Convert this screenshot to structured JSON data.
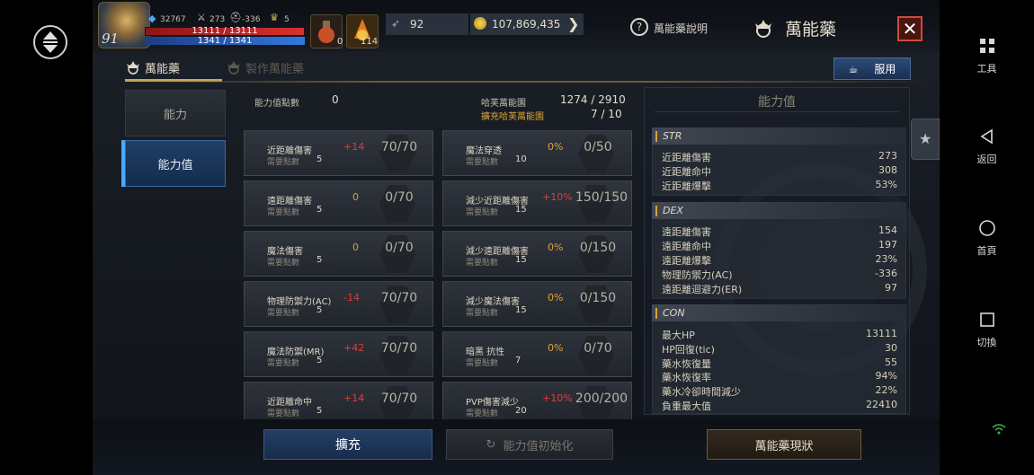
{
  "header": {
    "level": "91",
    "stat_crystal": "32767",
    "stat_sword": "273",
    "stat_helmet": "-336",
    "stat_trophy": "5",
    "hp": "13111 / 13111",
    "mp": "1341 / 1341",
    "item1_count": "0",
    "item2_count": "114",
    "crystals": "92",
    "gold": "107,869,435",
    "help_label": "萬能藥說明",
    "title": "萬能藥",
    "close_label": "✕"
  },
  "tabs": [
    {
      "label": "萬能藥"
    },
    {
      "label": "製作萬能藥"
    }
  ],
  "use_button": "服用",
  "nav": [
    {
      "label": "能力"
    },
    {
      "label": "能力值"
    }
  ],
  "summary": {
    "points_label": "能力值點數",
    "points_value": "0",
    "range_label": "哈芙萬能園",
    "range_value": "1274 / 2910",
    "expand_label": "擴充哈芙萬能園",
    "expand_value": "7 / 10"
  },
  "cards_left": [
    {
      "name": "近距離傷害",
      "req": "需要點數",
      "pts": "5",
      "bonus": "+14",
      "value": "70/70"
    },
    {
      "name": "遠距離傷害",
      "req": "需要點數",
      "pts": "5",
      "bonus": "0",
      "value": "0/70"
    },
    {
      "name": "魔法傷害",
      "req": "需要點數",
      "pts": "5",
      "bonus": "0",
      "value": "0/70"
    },
    {
      "name": "物理防禦力(AC)",
      "req": "需要點數",
      "pts": "5",
      "bonus": "-14",
      "value": "70/70"
    },
    {
      "name": "魔法防禦(MR)",
      "req": "需要點數",
      "pts": "5",
      "bonus": "+42",
      "value": "70/70"
    },
    {
      "name": "近距離命中",
      "req": "需要點數",
      "pts": "5",
      "bonus": "+14",
      "value": "70/70"
    }
  ],
  "cards_right": [
    {
      "name": "魔法穿透",
      "req": "需要點數",
      "pts": "10",
      "bonus": "0%",
      "value": "0/50"
    },
    {
      "name": "減少近距離傷害",
      "req": "需要點數",
      "pts": "15",
      "bonus": "+10%",
      "value": "150/150"
    },
    {
      "name": "減少遠距離傷害",
      "req": "需要點數",
      "pts": "15",
      "bonus": "0%",
      "value": "0/150"
    },
    {
      "name": "減少魔法傷害",
      "req": "需要點數",
      "pts": "15",
      "bonus": "0%",
      "value": "0/150"
    },
    {
      "name": "暗黑 抗性",
      "req": "需要點數",
      "pts": "7",
      "bonus": "0%",
      "value": "0/70"
    },
    {
      "name": "PVP傷害減少",
      "req": "需要點數",
      "pts": "20",
      "bonus": "+10%",
      "value": "200/200"
    }
  ],
  "panel": {
    "title": "能力值",
    "sections": [
      {
        "name": "STR",
        "rows": [
          {
            "label": "近距離傷害",
            "value": "273"
          },
          {
            "label": "近距離命中",
            "value": "308"
          },
          {
            "label": "近距離爆擊",
            "value": "53%"
          }
        ]
      },
      {
        "name": "DEX",
        "rows": [
          {
            "label": "遠距離傷害",
            "value": "154"
          },
          {
            "label": "遠距離命中",
            "value": "197"
          },
          {
            "label": "遠距離爆擊",
            "value": "23%"
          },
          {
            "label": "物理防禦力(AC)",
            "value": "-336"
          },
          {
            "label": "遠距離迴避力(ER)",
            "value": "97"
          }
        ]
      },
      {
        "name": "CON",
        "rows": [
          {
            "label": "最大HP",
            "value": "13111"
          },
          {
            "label": "HP回復(tic)",
            "value": "30"
          },
          {
            "label": "藥水恢復量",
            "value": "55"
          },
          {
            "label": "藥水恢復率",
            "value": "94%"
          },
          {
            "label": "藥水冷卻時間減少",
            "value": "22%"
          },
          {
            "label": "負重最大值",
            "value": "22410"
          }
        ]
      }
    ]
  },
  "bottom": {
    "expand": "擴充",
    "reset": "能力值初始化",
    "status": "萬能藥現狀"
  },
  "sidebar": {
    "tools": "工具",
    "back": "返回",
    "home": "首頁",
    "switch": "切換"
  }
}
